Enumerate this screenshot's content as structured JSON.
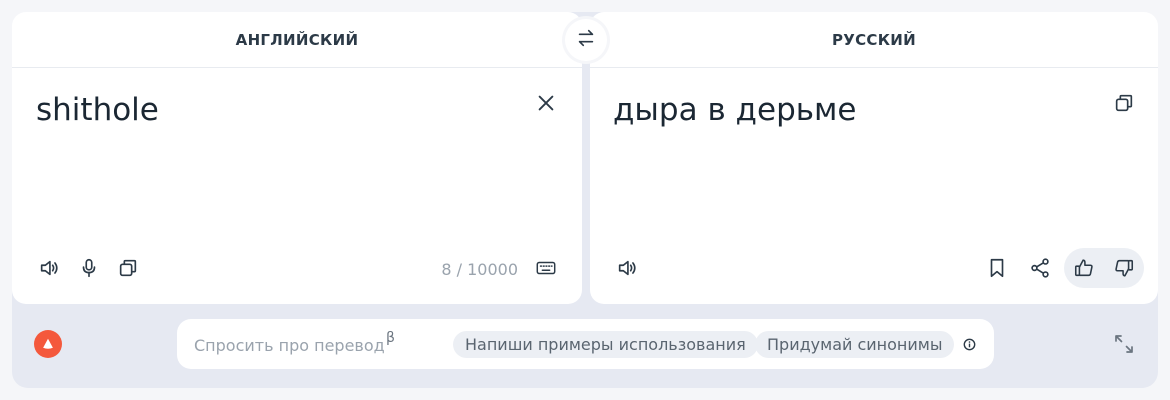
{
  "source_panel": {
    "language": "АНГЛИЙСКИЙ",
    "text": "shithole",
    "counter": "8 / 10000"
  },
  "target_panel": {
    "language": "РУССКИЙ",
    "text": "дыра в дерьме"
  },
  "ask": {
    "placeholder": "Спросить про перевод",
    "beta": "β",
    "chips": [
      "Напиши примеры использования",
      "Придумай синонимы"
    ]
  },
  "icons": {
    "clear": "close-icon",
    "swap": "swap-arrows-icon",
    "speak": "speaker-icon",
    "mic": "microphone-icon",
    "copy": "copy-icon",
    "keyboard": "keyboard-icon",
    "bookmark": "bookmark-icon",
    "share": "share-icon",
    "like": "thumbs-up-icon",
    "dislike": "thumbs-down-icon",
    "alice": "alice-logo-icon",
    "info": "info-icon",
    "expand": "expand-icon"
  },
  "colors": {
    "page_background": "#f5f6f9",
    "panel_background": "#ffffff",
    "bottom_area": "#e6e9f2",
    "alice_brand": "#f4583c",
    "text_primary": "#1b2733",
    "text_muted": "#9aa3ad"
  }
}
